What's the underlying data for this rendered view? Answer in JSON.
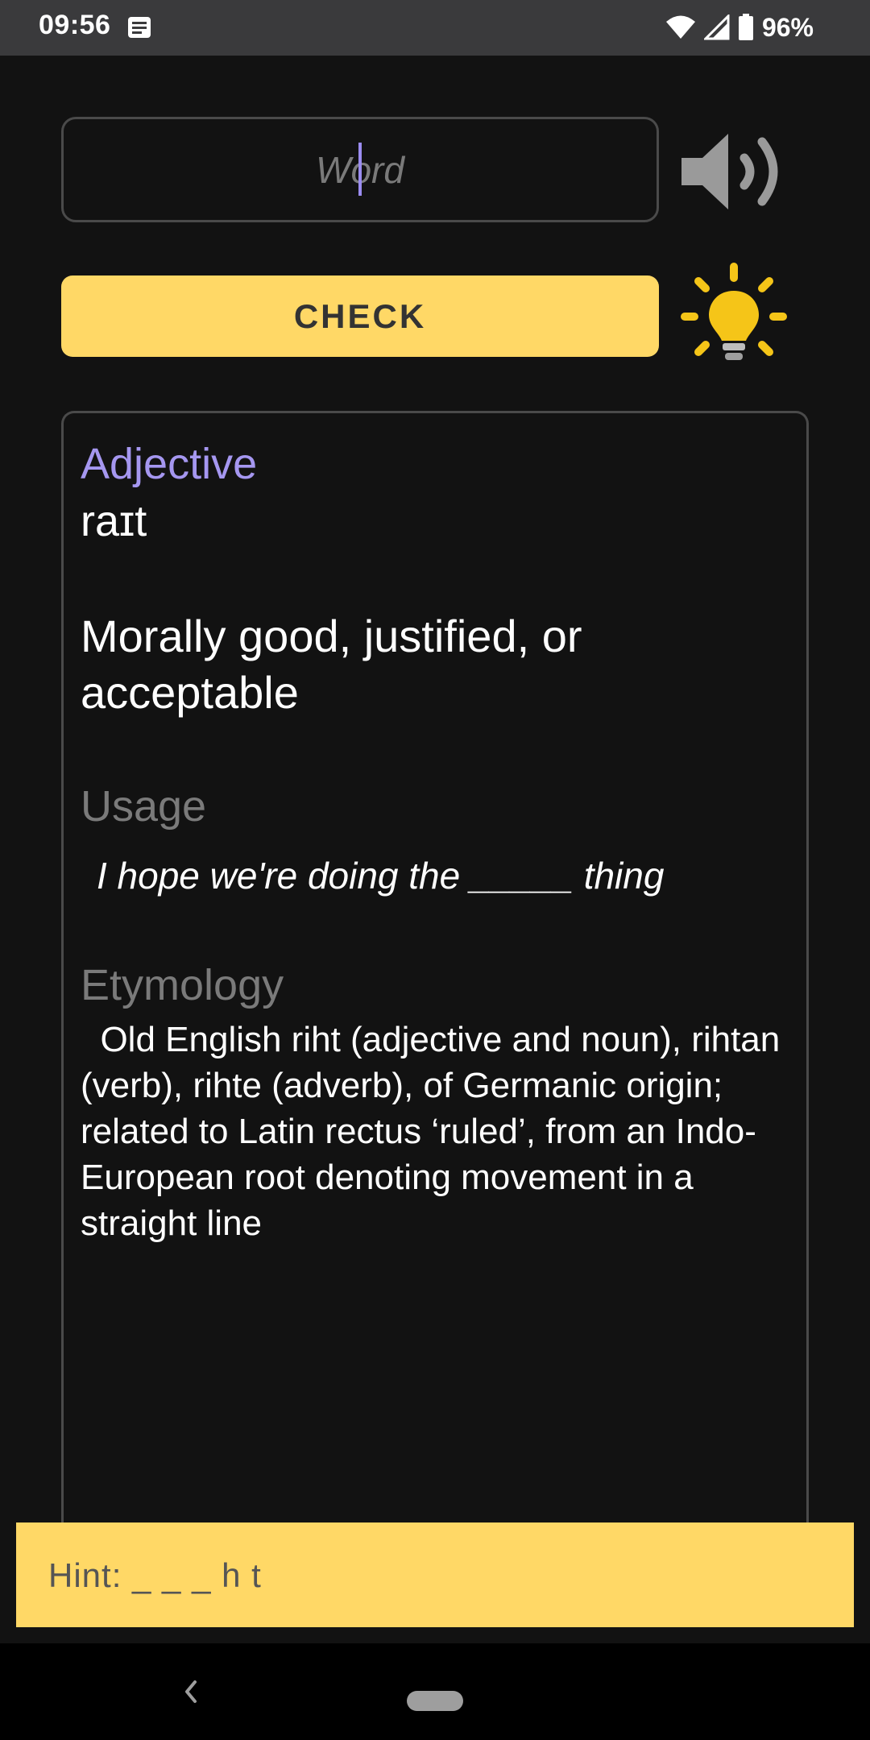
{
  "status_bar": {
    "time": "09:56",
    "battery": "96%",
    "icons": [
      "notification-icon",
      "wifi-icon",
      "cell-signal-icon",
      "battery-icon"
    ]
  },
  "word_input": {
    "placeholder": "Word",
    "value": ""
  },
  "speaker": {
    "icon": "speaker-icon"
  },
  "check_button": {
    "label": "CHECK"
  },
  "hint_button": {
    "icon": "lightbulb-icon"
  },
  "definition": {
    "part_of_speech": "Adjective",
    "phonetic": "raɪt",
    "meaning": "Morally good, justified, or acceptable",
    "usage_title": "Usage",
    "usage_text": "I hope we're doing the _____ thing",
    "etymology_title": "Etymology",
    "etymology_text": "  Old English riht (adjective and noun), rihtan (verb), rihte (adverb), of Germanic origin; related to Latin rectus ‘ruled’, from an Indo-European root denoting movement in a straight line"
  },
  "hint": {
    "text": "Hint: _ _ _ h t"
  },
  "colors": {
    "background": "#121212",
    "accent_yellow": "#ffd866",
    "part_of_speech": "#a597f0",
    "section_title": "#7a7a7a",
    "bulb": "#f5c518"
  }
}
